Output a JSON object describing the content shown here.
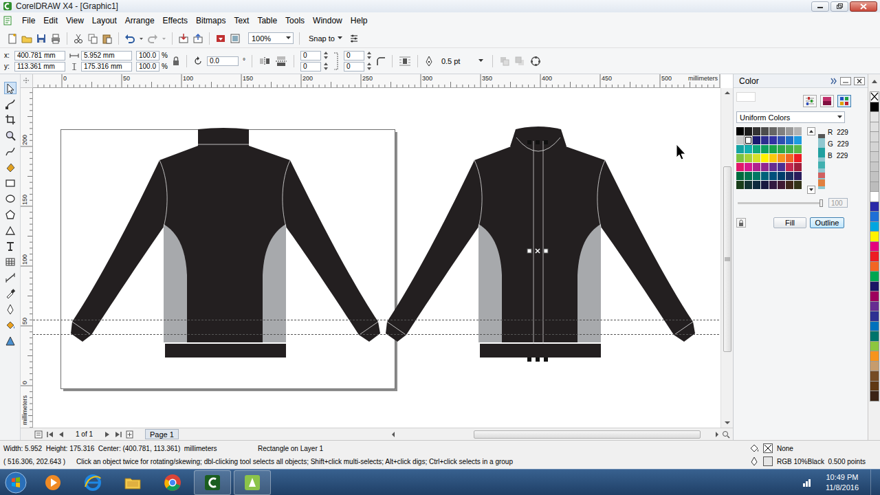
{
  "window": {
    "title": "CorelDRAW X4 - [Graphic1]"
  },
  "menu": [
    "File",
    "Edit",
    "View",
    "Layout",
    "Arrange",
    "Effects",
    "Bitmaps",
    "Text",
    "Table",
    "Tools",
    "Window",
    "Help"
  ],
  "toolbar": {
    "zoom": "100%",
    "snap": "Snap to"
  },
  "property_bar": {
    "x_label": "x:",
    "x": "400.781 mm",
    "y_label": "y:",
    "y": "113.361 mm",
    "width": "5.952 mm",
    "height": "175.316 mm",
    "scale_x": "100.0",
    "scale_y": "100.0",
    "scale_units": [
      "%",
      "%"
    ],
    "rotation": "0.0",
    "degree": "°",
    "corners": [
      "0",
      "0",
      "0",
      "0"
    ],
    "outline_width": "0.5 pt"
  },
  "ruler": {
    "top": [
      "0",
      "50",
      "100",
      "150",
      "200",
      "250",
      "300",
      "350",
      "400",
      "450",
      "500"
    ],
    "unit": "millimeters",
    "left": [
      "200",
      "150",
      "100",
      "50",
      "0"
    ],
    "left_unit": "millimeters"
  },
  "page_nav": {
    "count": "1 of 1",
    "tab": "Page 1"
  },
  "docker": {
    "title": "Color",
    "model": "Uniform Colors",
    "channels": [
      {
        "label": "R",
        "value": "229"
      },
      {
        "label": "G",
        "value": "229"
      },
      {
        "label": "B",
        "value": "229"
      }
    ],
    "tint": "100",
    "fill_button": "Fill",
    "outline_button": "Outline",
    "swatches": [
      {
        "color": "#000000",
        "selected": false
      },
      {
        "color": "#1a1a1a",
        "selected": false
      },
      {
        "color": "#333333",
        "selected": false
      },
      {
        "color": "#4d4d4d",
        "selected": false
      },
      {
        "color": "#666666",
        "selected": false
      },
      {
        "color": "#808080",
        "selected": false
      },
      {
        "color": "#999999",
        "selected": false
      },
      {
        "color": "#b3b3b3",
        "selected": false
      },
      {
        "color": "#cccccc",
        "selected": false
      },
      {
        "color": "#ffffff",
        "selected": true
      },
      {
        "color": "#1a1a6e",
        "selected": false
      },
      {
        "color": "#2e2e8f",
        "selected": false
      },
      {
        "color": "#3333a3",
        "selected": false
      },
      {
        "color": "#2e4fb0",
        "selected": false
      },
      {
        "color": "#1f6fc6",
        "selected": false
      },
      {
        "color": "#1e9be0",
        "selected": false
      },
      {
        "color": "#15a3a3",
        "selected": false
      },
      {
        "color": "#14b0b0",
        "selected": false
      },
      {
        "color": "#10a87a",
        "selected": false
      },
      {
        "color": "#0fa060",
        "selected": false
      },
      {
        "color": "#1aa34a",
        "selected": false
      },
      {
        "color": "#2ea84a",
        "selected": false
      },
      {
        "color": "#44b04a",
        "selected": false
      },
      {
        "color": "#58b84a",
        "selected": false
      },
      {
        "color": "#7cc242",
        "selected": false
      },
      {
        "color": "#a6d13a",
        "selected": false
      },
      {
        "color": "#d3e02a",
        "selected": false
      },
      {
        "color": "#fff200",
        "selected": false
      },
      {
        "color": "#fcc80e",
        "selected": false
      },
      {
        "color": "#f7941d",
        "selected": false
      },
      {
        "color": "#f26522",
        "selected": false
      },
      {
        "color": "#ed1c24",
        "selected": false
      },
      {
        "color": "#e2186b",
        "selected": false
      },
      {
        "color": "#d7198e",
        "selected": false
      },
      {
        "color": "#b0208f",
        "selected": false
      },
      {
        "color": "#92278f",
        "selected": false
      },
      {
        "color": "#662d91",
        "selected": false
      },
      {
        "color": "#4b3092",
        "selected": false
      },
      {
        "color": "#c4264f",
        "selected": false
      },
      {
        "color": "#a01e3c",
        "selected": false
      },
      {
        "color": "#006b3e",
        "selected": false
      },
      {
        "color": "#00734f",
        "selected": false
      },
      {
        "color": "#007864",
        "selected": false
      },
      {
        "color": "#00617a",
        "selected": false
      },
      {
        "color": "#004f7c",
        "selected": false
      },
      {
        "color": "#003d6b",
        "selected": false
      },
      {
        "color": "#1c2d5e",
        "selected": false
      },
      {
        "color": "#2a1d5c",
        "selected": false
      },
      {
        "color": "#1a3d1a",
        "selected": false
      },
      {
        "color": "#123333",
        "selected": false
      },
      {
        "color": "#0d2a3d",
        "selected": false
      },
      {
        "color": "#1a1a40",
        "selected": false
      },
      {
        "color": "#331a40",
        "selected": false
      },
      {
        "color": "#401a33",
        "selected": false
      },
      {
        "color": "#40261a",
        "selected": false
      },
      {
        "color": "#333318",
        "selected": false
      }
    ]
  },
  "palette": [
    {
      "kind": "none",
      "color": "#ffffff"
    },
    {
      "kind": "swatch",
      "color": "#000000"
    },
    {
      "kind": "swatch",
      "color": "#e6e6e6"
    },
    {
      "kind": "swatch",
      "color": "#e0e0e0"
    },
    {
      "kind": "swatch",
      "color": "#dadada"
    },
    {
      "kind": "swatch",
      "color": "#d4d4d4"
    },
    {
      "kind": "swatch",
      "color": "#cecece"
    },
    {
      "kind": "swatch",
      "color": "#c8c8c8"
    },
    {
      "kind": "swatch",
      "color": "#c2c2c2"
    },
    {
      "kind": "swatch",
      "color": "#bcbcbc"
    },
    {
      "kind": "swatch",
      "color": "#ffffff"
    },
    {
      "kind": "swatch",
      "color": "#2a2aa8"
    },
    {
      "kind": "swatch",
      "color": "#1f6fd6"
    },
    {
      "kind": "swatch",
      "color": "#00a6e0"
    },
    {
      "kind": "swatch",
      "color": "#fff200"
    },
    {
      "kind": "swatch",
      "color": "#e5007d"
    },
    {
      "kind": "swatch",
      "color": "#ed1c24"
    },
    {
      "kind": "swatch",
      "color": "#f26522"
    },
    {
      "kind": "swatch",
      "color": "#00a651"
    },
    {
      "kind": "swatch",
      "color": "#1b1464"
    },
    {
      "kind": "swatch",
      "color": "#9e005d"
    },
    {
      "kind": "swatch",
      "color": "#662d91"
    },
    {
      "kind": "swatch",
      "color": "#2e3192"
    },
    {
      "kind": "swatch",
      "color": "#0072bc"
    },
    {
      "kind": "swatch",
      "color": "#00746b"
    },
    {
      "kind": "swatch",
      "color": "#8dc63f"
    },
    {
      "kind": "swatch",
      "color": "#f7941d"
    },
    {
      "kind": "swatch",
      "color": "#c69c6d"
    },
    {
      "kind": "swatch",
      "color": "#754c24"
    },
    {
      "kind": "swatch",
      "color": "#603913"
    },
    {
      "kind": "swatch",
      "color": "#3c2415"
    }
  ],
  "status_bar": {
    "dimensions": "Width: 5.952  Height: 175.316  Center: (400.781, 113.361)  millimeters",
    "object": "Rectangle on Layer 1",
    "cursor": "( 516.306, 202.643 )",
    "hint": "Click an object twice for rotating/skewing; dbl-clicking tool selects all objects; Shift+click multi-selects; Alt+click digs; Ctrl+click selects in a group",
    "fill": "None",
    "outline": "RGB 10%Black  0.500 points"
  },
  "taskbar": {
    "time": "10:49 PM",
    "date": "11/8/2016"
  }
}
